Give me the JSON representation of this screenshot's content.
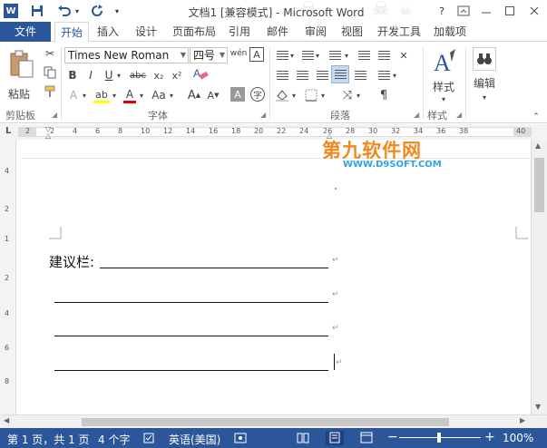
{
  "window": {
    "title": "文档1 [兼容模式] - Microsoft Word",
    "app_icon_text": "W",
    "help": "?"
  },
  "tabs": [
    "文件",
    "开始",
    "插入",
    "设计",
    "页面布局",
    "引用",
    "邮件",
    "审阅",
    "视图",
    "开发工具",
    "加载项"
  ],
  "ribbon": {
    "font_name": "Times New Roman",
    "font_size": "四号",
    "paste_label": "粘贴",
    "styles_label": "样式",
    "edit_label": "编辑",
    "groups": {
      "clipboard": "剪贴板",
      "font": "字体",
      "paragraph": "段落",
      "styles": "样式"
    },
    "buttons": {
      "bold": "B",
      "italic": "I",
      "underline": "U",
      "strike": "abc",
      "subscript": "x₂",
      "superscript": "x²",
      "wen": "wén",
      "text_effect": "A",
      "highlight": "ab",
      "font_color": "A",
      "change_case": "Aa",
      "grow": "A",
      "shrink": "A",
      "char_shade": "A",
      "enclose": "字",
      "char_border": "A"
    },
    "colors": {
      "highlight": "#ffff00",
      "font_color": "#e00000"
    }
  },
  "ruler": {
    "ticks": [
      "2",
      "2",
      "4",
      "6",
      "8",
      "10",
      "12",
      "14",
      "16",
      "18",
      "20",
      "22",
      "24",
      "26",
      "28",
      "30",
      "32",
      "34",
      "36",
      "38",
      "40"
    ],
    "vticks": [
      "4",
      "2",
      "1",
      "2",
      "4",
      "6",
      "8"
    ]
  },
  "document": {
    "label": "建议栏:",
    "para_mark": "↵"
  },
  "watermark": {
    "logo": "第九软件网",
    "url": "WWW.D9SOFT.COM"
  },
  "statusbar": {
    "page": "第 1 页，共 1 页",
    "words": "4 个字",
    "language": "英语(美国)",
    "zoom_minus": "−",
    "zoom_plus": "+",
    "zoom": "100%"
  },
  "accent": "#2b579a"
}
